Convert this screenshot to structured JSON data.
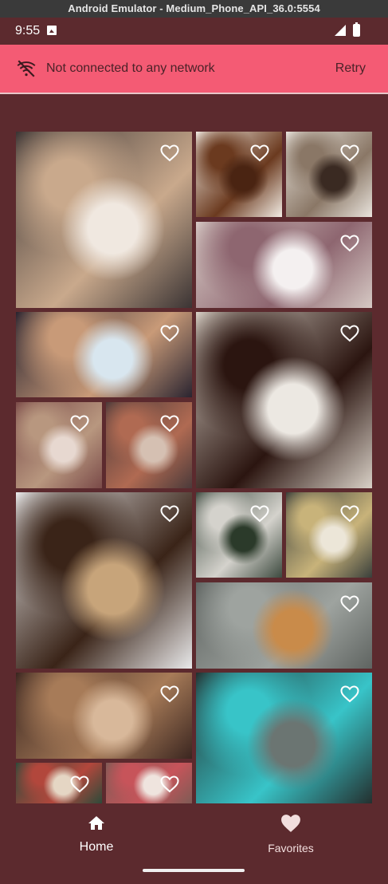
{
  "window": {
    "title": "Android Emulator - Medium_Phone_API_36.0:5554"
  },
  "status_bar": {
    "time": "9:55"
  },
  "banner": {
    "message": "Not connected to any network",
    "retry_label": "Retry",
    "color": "#f45b74"
  },
  "theme": {
    "background": "#5c2a2e"
  },
  "gallery": {
    "items": [
      {
        "name": "photo-latte-cookies",
        "palette": [
          "#3b3434",
          "#c9a98c",
          "#f0e8e0"
        ]
      },
      {
        "name": "photo-coffee-beans",
        "palette": [
          "#f2ece4",
          "#6b3a1f",
          "#4a2412"
        ]
      },
      {
        "name": "photo-pour-over-kettle",
        "palette": [
          "#e9e4dd",
          "#8a7766",
          "#3a2a22"
        ]
      },
      {
        "name": "photo-latte-art-wide",
        "palette": [
          "#d6c9c4",
          "#8e6670",
          "#f4f0f0"
        ]
      },
      {
        "name": "photo-latte-art-saucer",
        "palette": [
          "#2a2430",
          "#c89a78",
          "#d8e6ef"
        ]
      },
      {
        "name": "photo-black-coffee-flowers",
        "palette": [
          "#d8d0c6",
          "#2b1510",
          "#ece8e2"
        ]
      },
      {
        "name": "photo-milk-coffee-cup",
        "palette": [
          "#7a4a48",
          "#b8977f",
          "#e7d8d0"
        ]
      },
      {
        "name": "photo-phone-coffee",
        "palette": [
          "#4b3a3a",
          "#b06a52",
          "#d5c0b2"
        ]
      },
      {
        "name": "photo-bag-of-beans",
        "palette": [
          "#e9e9ea",
          "#3a2418",
          "#c7a47a"
        ]
      },
      {
        "name": "photo-plant-brewer",
        "palette": [
          "#3d4a3f",
          "#d4d2cc",
          "#2b3a2a"
        ]
      },
      {
        "name": "photo-espresso-glass",
        "palette": [
          "#3a3f3b",
          "#c8b37a",
          "#ece6d8"
        ]
      },
      {
        "name": "photo-marble-coffee-top",
        "palette": [
          "#5f6461",
          "#9ea39f",
          "#c98b4a"
        ]
      },
      {
        "name": "photo-kettle-grinder",
        "palette": [
          "#3b2620",
          "#a77b58",
          "#d8b89a"
        ]
      },
      {
        "name": "photo-neon-but-first-coffee",
        "palette": [
          "#24302f",
          "#38c4c8",
          "#6b7572"
        ]
      },
      {
        "name": "photo-christmas-coffee",
        "palette": [
          "#2d4a3a",
          "#b2473c",
          "#e5d6c4"
        ]
      },
      {
        "name": "photo-red-scarf-cup",
        "palette": [
          "#7e5b55",
          "#c7545a",
          "#efe4de"
        ]
      }
    ]
  },
  "bottom_nav": {
    "items": [
      {
        "label": "Home",
        "icon": "home-icon"
      },
      {
        "label": "Favorites",
        "icon": "heart-icon"
      }
    ]
  }
}
